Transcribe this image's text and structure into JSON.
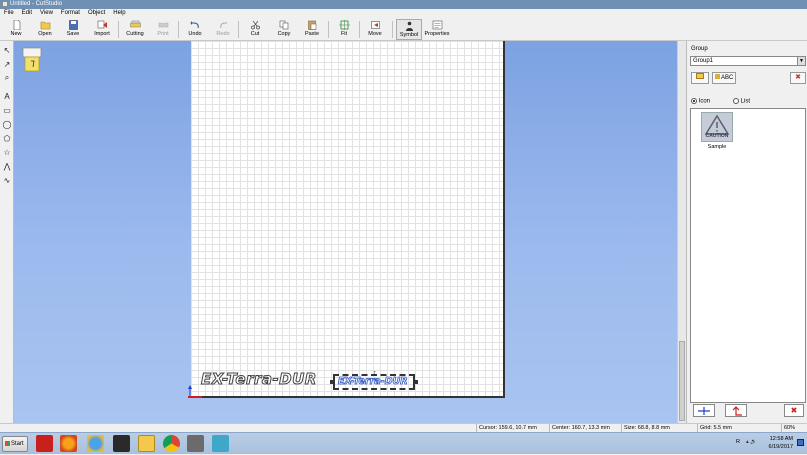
{
  "window": {
    "title": "Untitled - CutStudio"
  },
  "menu": [
    "File",
    "Edit",
    "View",
    "Format",
    "Object",
    "Help"
  ],
  "toolbar": {
    "new": "New",
    "open": "Open",
    "save": "Save",
    "import": "Import",
    "cutting": "Cutting",
    "print": "Print",
    "undo": "Undo",
    "redo": "Redo",
    "cut": "Cut",
    "copy": "Copy",
    "paste": "Paste",
    "fit": "Fit",
    "move": "Move",
    "symbol": "Symbol",
    "properties": "Properties"
  },
  "canvas": {
    "text_outline": "EX-Terra-DUR",
    "text_selected": "EX-Terra-DUR"
  },
  "panel": {
    "group_label": "Group",
    "group_value": "Group1",
    "abc_button": "ABC",
    "view_icon": "Icon",
    "view_list": "List",
    "symbol_text": "CAUTION",
    "symbol_name": "Sample"
  },
  "status": {
    "cursor": "Cursor: 159.6, 10.7 mm",
    "center": "Center: 160.7, 13.3 mm",
    "size": "Size: 68.8, 8.8 mm",
    "grid": "Grid: 5.5 mm",
    "zoom": "60%"
  },
  "taskbar": {
    "start": "Start",
    "time": "12:58 AM",
    "date": "6/19/2017"
  }
}
